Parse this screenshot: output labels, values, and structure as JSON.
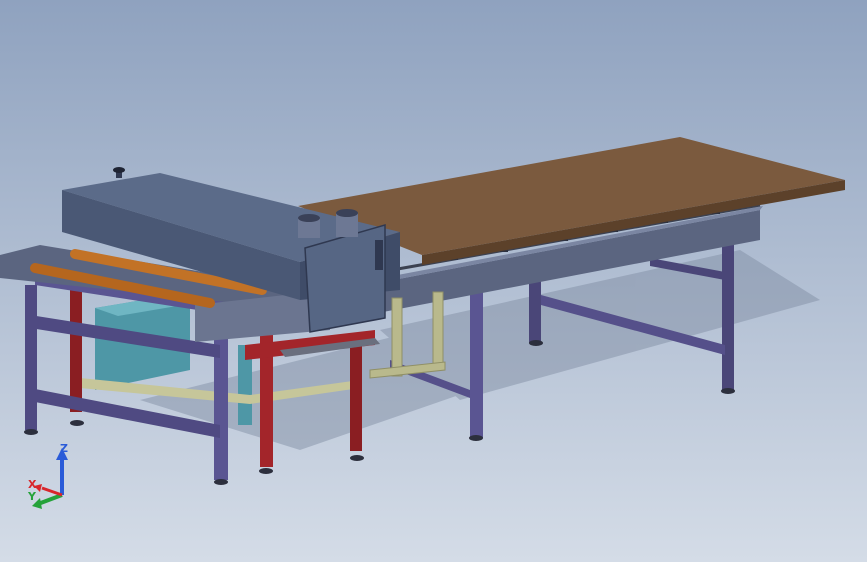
{
  "viewport": {
    "background_top": "#8fa2bf",
    "background_bottom": "#d4dce7"
  },
  "model": {
    "colors": {
      "table_top": "#7b5a3e",
      "table_top_edge": "#5c412a",
      "housing": "#4f5f7c",
      "housing_dark": "#3a4760",
      "frame_purple": "#4f4a82",
      "frame_red": "#8a1e22",
      "frame_yellow": "#b9b98c",
      "frame_cyan": "#4e97a6",
      "roller": "#b5661e",
      "rail_steel": "#5b6580"
    }
  },
  "triad": {
    "x_label": "X",
    "y_label": "Y",
    "z_label": "Z",
    "x_color": "#d8262b",
    "y_color": "#25a23a",
    "z_color": "#2a5bd8"
  }
}
